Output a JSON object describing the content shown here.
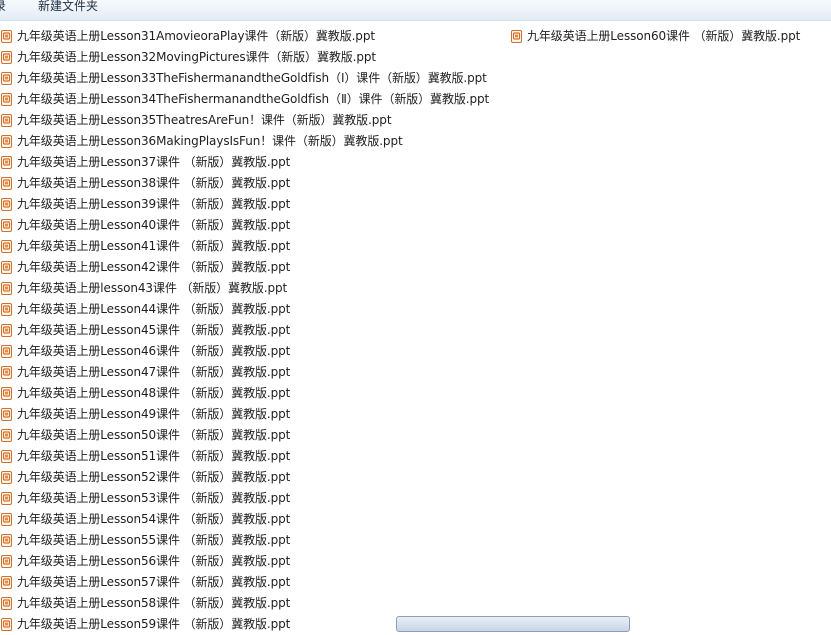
{
  "toolbar": {
    "left_fragment": "录",
    "new_folder_label": "新建文件夹"
  },
  "files_col1": [
    "九年级英语上册Lesson31AmovieoraPlay课件（新版）冀教版.ppt",
    "九年级英语上册Lesson32MovingPictures课件（新版）冀教版.ppt",
    "九年级英语上册Lesson33TheFishermanandtheGoldfish（Ⅰ）课件（新版）冀教版.ppt",
    "九年级英语上册Lesson34TheFishermanandtheGoldfish（Ⅱ）课件（新版）冀教版.ppt",
    "九年级英语上册Lesson35TheatresAreFun！课件（新版）冀教版.ppt",
    "九年级英语上册Lesson36MakingPlaysIsFun！课件（新版）冀教版.ppt",
    "九年级英语上册Lesson37课件 （新版）冀教版.ppt",
    "九年级英语上册Lesson38课件 （新版）冀教版.ppt",
    "九年级英语上册Lesson39课件 （新版）冀教版.ppt",
    "九年级英语上册Lesson40课件 （新版）冀教版.ppt",
    "九年级英语上册Lesson41课件 （新版）冀教版.ppt",
    "九年级英语上册Lesson42课件 （新版）冀教版.ppt",
    "九年级英语上册lesson43课件 （新版）冀教版.ppt",
    "九年级英语上册Lesson44课件 （新版）冀教版.ppt",
    "九年级英语上册Lesson45课件 （新版）冀教版.ppt",
    "九年级英语上册Lesson46课件 （新版）冀教版.ppt",
    "九年级英语上册Lesson47课件 （新版）冀教版.ppt",
    "九年级英语上册Lesson48课件 （新版）冀教版.ppt",
    "九年级英语上册Lesson49课件 （新版）冀教版.ppt",
    "九年级英语上册Lesson50课件 （新版）冀教版.ppt",
    "九年级英语上册Lesson51课件 （新版）冀教版.ppt",
    "九年级英语上册Lesson52课件 （新版）冀教版.ppt",
    "九年级英语上册Lesson53课件 （新版）冀教版.ppt",
    "九年级英语上册Lesson54课件 （新版）冀教版.ppt",
    "九年级英语上册Lesson55课件 （新版）冀教版.ppt",
    "九年级英语上册Lesson56课件 （新版）冀教版.ppt",
    "九年级英语上册Lesson57课件 （新版）冀教版.ppt",
    "九年级英语上册Lesson58课件 （新版）冀教版.ppt",
    "九年级英语上册Lesson59课件 （新版）冀教版.ppt"
  ],
  "files_col2": [
    "九年级英语上册Lesson60课件 （新版）冀教版.ppt"
  ],
  "icon": "ppt-file-icon"
}
